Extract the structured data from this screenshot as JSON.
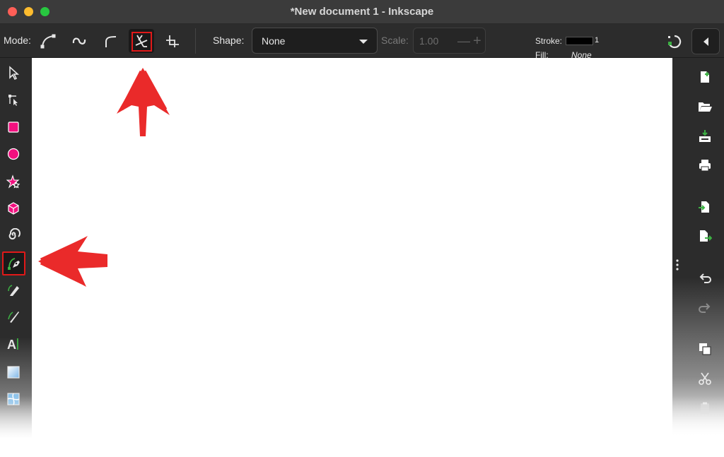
{
  "window": {
    "title": "*New document 1 - Inkscape"
  },
  "tool_controls": {
    "mode_label": "Mode:",
    "modes": [
      {
        "name": "regular-bezier",
        "icon": "bezier-mode-icon",
        "active": false
      },
      {
        "name": "spiro",
        "icon": "spiro-mode-icon",
        "active": false
      },
      {
        "name": "bspline",
        "icon": "bspline-mode-icon",
        "active": false
      },
      {
        "name": "paraxial",
        "icon": "paraxial-mode-icon",
        "active": true
      },
      {
        "name": "straight",
        "icon": "straight-mode-icon",
        "active": false
      }
    ],
    "shape_label": "Shape:",
    "shape_value": "None",
    "scale_label": "Scale:",
    "scale_value": "1.00",
    "fill_label": "Fill:",
    "fill_value": "None",
    "stroke_label": "Stroke:",
    "stroke_width": "1",
    "stroke_color": "#000000"
  },
  "toolbox": [
    {
      "name": "selector-tool",
      "icon": "arrow-pointer-icon"
    },
    {
      "name": "node-tool",
      "icon": "node-editor-icon"
    },
    {
      "name": "rectangle-tool",
      "icon": "rectangle-icon",
      "color": "#f2107f"
    },
    {
      "name": "ellipse-tool",
      "icon": "circle-icon",
      "color": "#f2107f"
    },
    {
      "name": "star-tool",
      "icon": "star-icon",
      "color": "#f2107f"
    },
    {
      "name": "3d-box-tool",
      "icon": "cube-icon",
      "color": "#f2107f"
    },
    {
      "name": "spiral-tool",
      "icon": "spiral-icon"
    },
    {
      "name": "pen-tool",
      "icon": "pen-icon",
      "selected": true
    },
    {
      "name": "pencil-tool",
      "icon": "pencil-icon"
    },
    {
      "name": "calligraphy-tool",
      "icon": "calligraphy-icon"
    },
    {
      "name": "text-tool",
      "icon": "text-icon",
      "glyph": "A"
    },
    {
      "name": "gradient-tool",
      "icon": "gradient-icon"
    },
    {
      "name": "mesh-tool",
      "icon": "mesh-icon"
    }
  ],
  "commands": [
    {
      "name": "new-document",
      "icon": "new-file-icon"
    },
    {
      "name": "open-document",
      "icon": "folder-open-icon"
    },
    {
      "name": "save-document",
      "icon": "save-icon"
    },
    {
      "name": "print-document",
      "icon": "printer-icon"
    },
    {
      "name": "import",
      "icon": "import-icon"
    },
    {
      "name": "export",
      "icon": "export-icon"
    },
    {
      "name": "undo",
      "icon": "undo-icon"
    },
    {
      "name": "redo",
      "icon": "redo-icon"
    },
    {
      "name": "copy",
      "icon": "copy-icon"
    },
    {
      "name": "cut",
      "icon": "scissors-icon"
    },
    {
      "name": "paste",
      "icon": "clipboard-icon"
    }
  ],
  "colors": {
    "highlight": "#e11919",
    "annotation_arrow": "#ea2a2a",
    "accent_green": "#3cb043",
    "shape_pink": "#f2107f"
  }
}
